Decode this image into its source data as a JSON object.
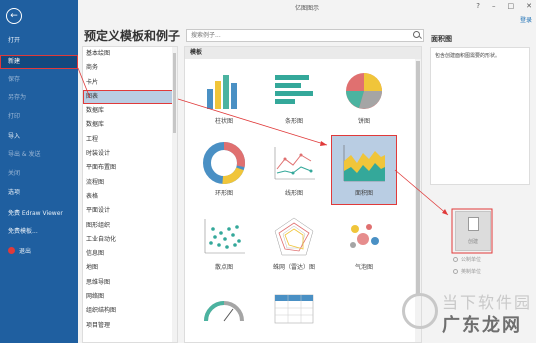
{
  "window": {
    "title": "亿图图示",
    "login": "登录"
  },
  "nav": {
    "items": [
      {
        "label": "打开",
        "dim": false
      },
      {
        "label": "新建",
        "dim": false,
        "active": true
      },
      {
        "label": "保存",
        "dim": true
      },
      {
        "label": "另存为",
        "dim": true
      },
      {
        "label": "打印",
        "dim": true
      },
      {
        "label": "导入",
        "dim": false
      },
      {
        "label": "导出 & 发送",
        "dim": true
      },
      {
        "label": "关闭",
        "dim": true
      },
      {
        "label": "选项",
        "dim": false
      },
      {
        "label": "免费 Edraw Viewer",
        "dim": false
      },
      {
        "label": "免费模板...",
        "dim": false
      },
      {
        "label": "退出",
        "dim": false,
        "icon": true
      }
    ]
  },
  "main": {
    "title": "预定义模板和例子",
    "search_placeholder": "搜索例子..."
  },
  "categories": [
    "基本绘图",
    "商务",
    "卡片",
    "图表",
    "数据库",
    "数据库",
    "工程",
    "时装设计",
    "平面布置图",
    "流程图",
    "表格",
    "平面设计",
    "图形组织",
    "工业自动化",
    "信息图",
    "地图",
    "思维导图",
    "网络图",
    "组织结构图",
    "项目管理"
  ],
  "categories_selected_index": 3,
  "grid": {
    "header": "模板",
    "tiles": [
      {
        "label": "柱状图",
        "icon": "bar-chart-icon"
      },
      {
        "label": "条形图",
        "icon": "horizontal-bar-icon"
      },
      {
        "label": "饼图",
        "icon": "pie-chart-icon"
      },
      {
        "label": "环形图",
        "icon": "donut-chart-icon"
      },
      {
        "label": "线形图",
        "icon": "line-chart-icon"
      },
      {
        "label": "面积图",
        "icon": "area-chart-icon",
        "selected": true
      },
      {
        "label": "散点图",
        "icon": "scatter-chart-icon"
      },
      {
        "label": "蛛网（雷达）图",
        "icon": "radar-chart-icon"
      },
      {
        "label": "气泡图",
        "icon": "bubble-chart-icon"
      },
      {
        "label": "",
        "icon": "gauge-chart-icon"
      },
      {
        "label": "",
        "icon": "table-chart-icon"
      }
    ]
  },
  "right": {
    "title": "面积图",
    "desc": "包含创建面积图需要的形状。",
    "create_label": "创建",
    "options": [
      "公制单位",
      "英制单位"
    ]
  },
  "watermark": {
    "line1": "当下软件园",
    "line2": "广东龙网"
  },
  "colors": {
    "nav_bg": "#1f5fa0",
    "highlight": "#e03a3a",
    "selected_bg": "#b9cde3",
    "chart_blue": "#4a90c4",
    "chart_green": "#4bb3a0",
    "chart_teal": "#34a89a",
    "chart_yellow": "#f0c53a",
    "chart_red": "#e07070",
    "chart_grey": "#a5a5a5"
  }
}
